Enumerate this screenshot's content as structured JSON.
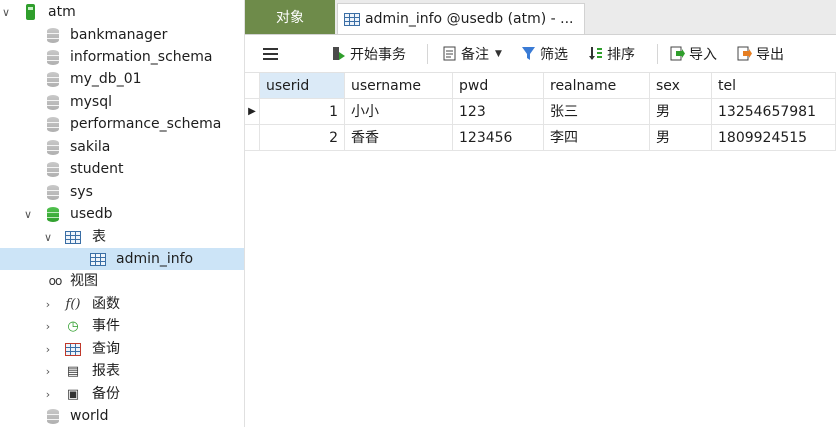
{
  "sidebar": {
    "connection": "atm",
    "databases_before": [
      "bankmanager",
      "information_schema",
      "my_db_01",
      "mysql",
      "performance_schema",
      "sakila",
      "student",
      "sys"
    ],
    "active_db": "usedb",
    "tables_group": "表",
    "selected_table": "admin_info",
    "groups": [
      "视图",
      "函数",
      "事件",
      "查询",
      "报表",
      "备份"
    ],
    "databases_after": [
      "world"
    ]
  },
  "tabs": {
    "objects": "对象",
    "document": "admin_info @usedb (atm) - ..."
  },
  "toolbar": {
    "begin_transaction": "开始事务",
    "note": "备注",
    "filter": "筛选",
    "sort": "排序",
    "import": "导入",
    "export": "导出"
  },
  "table": {
    "columns": [
      "userid",
      "username",
      "pwd",
      "realname",
      "sex",
      "tel"
    ],
    "rows": [
      [
        "1",
        "小小",
        "123",
        "张三",
        "男",
        "13254657981"
      ],
      [
        "2",
        "香香",
        "123456",
        "李四",
        "男",
        "1809924515"
      ]
    ]
  }
}
